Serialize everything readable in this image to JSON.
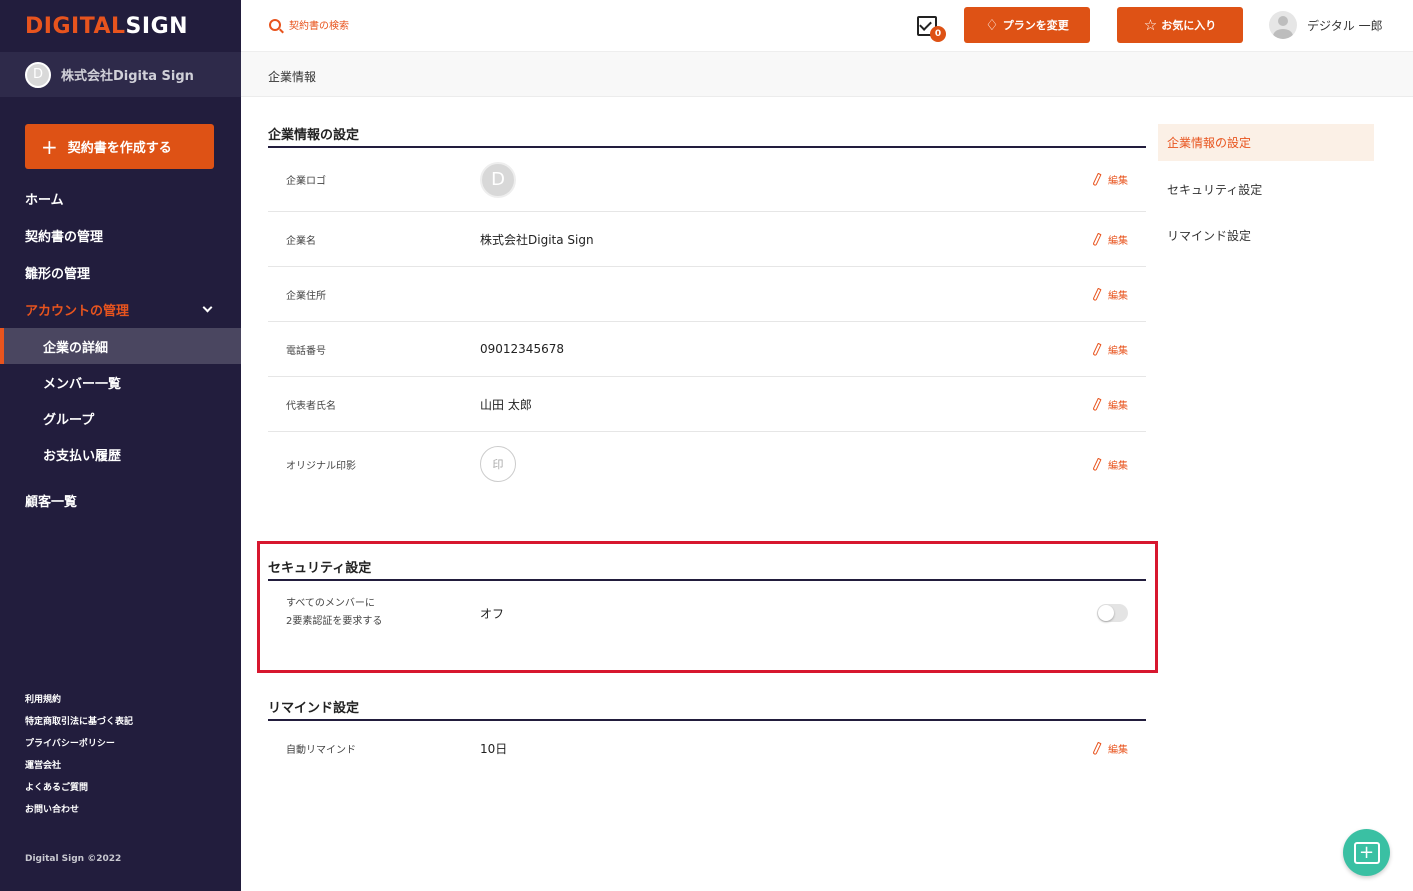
{
  "brand": {
    "logo_part1": "DIGITAL",
    "logo_part2": "SIGN",
    "accent": "#de5215",
    "sidebar_bg": "#221d3d"
  },
  "org": {
    "initial": "D",
    "name": "株式会社Digita Sign"
  },
  "sidebar": {
    "create_button": "契約書を作成する",
    "items": {
      "home": "ホーム",
      "contracts": "契約書の管理",
      "templates": "雛形の管理",
      "account": "アカウントの管理",
      "company_detail": "企業の詳細",
      "members": "メンバー一覧",
      "groups": "グループ",
      "payments": "お支払い履歴",
      "customers": "顧客一覧"
    },
    "footer": [
      "利用規約",
      "特定商取引法に基づく表記",
      "プライバシーポリシー",
      "運営会社",
      "よくあるご質問",
      "お問い合わせ"
    ],
    "copyright": "Digital Sign ©2022"
  },
  "header": {
    "search_placeholder": "契約書の検索",
    "task_count": "0",
    "plan_button": "プランを変更",
    "favorite_button": "お気に入り",
    "user_name": "デジタル 一郎"
  },
  "page": {
    "title": "企業情報"
  },
  "company_section": {
    "title": "企業情報の設定",
    "edit_label": "編集",
    "rows": {
      "logo_label": "企業ロゴ",
      "logo_initial": "D",
      "name_label": "企業名",
      "name_value": "株式会社Digita Sign",
      "address_label": "企業住所",
      "address_value": "",
      "phone_label": "電話番号",
      "phone_value": "09012345678",
      "rep_label": "代表者氏名",
      "rep_value": "山田 太郎",
      "seal_label": "オリジナル印影",
      "seal_glyph": "印"
    }
  },
  "security_section": {
    "title": "セキュリティ設定",
    "label_line1": "すべてのメンバーに",
    "label_line2": "2要素認証を要求する",
    "value": "オフ",
    "toggle_on": false
  },
  "remind_section": {
    "title": "リマインド設定",
    "label": "自動リマインド",
    "value": "10日",
    "edit_label": "編集"
  },
  "right_nav": [
    "企業情報の設定",
    "セキュリティ設定",
    "リマインド設定"
  ]
}
